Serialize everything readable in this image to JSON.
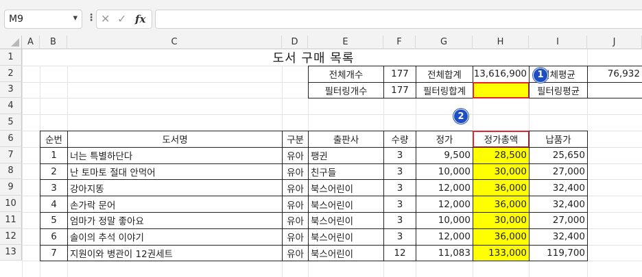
{
  "formula_bar": {
    "name_box": "M9",
    "chevron": "▾",
    "more": "⋮",
    "cancel": "✕",
    "enter": "✓",
    "fx": "fx",
    "formula": ""
  },
  "columns": [
    "A",
    "B",
    "C",
    "D",
    "E",
    "F",
    "G",
    "H",
    "I",
    "J"
  ],
  "rows": [
    "1",
    "2",
    "3",
    "4",
    "5",
    "6",
    "7",
    "8",
    "9",
    "10",
    "11",
    "12",
    "13"
  ],
  "sheet": {
    "title": "도서 구매 목록",
    "summary": {
      "total_count_label": "전체개수",
      "total_count": "177",
      "total_sum_label": "전체합계",
      "total_sum": "13,616,900",
      "total_avg_label": "전체평균",
      "total_avg": "76,932",
      "filter_count_label": "필터링개수",
      "filter_count": "177",
      "filter_sum_label": "필터링합계",
      "filter_sum": "",
      "filter_avg_label": "필터링평균",
      "filter_avg": ""
    },
    "table_headers": [
      "순번",
      "도서명",
      "구분",
      "출판사",
      "수량",
      "정가",
      "정가총액",
      "납품가"
    ],
    "table_rows": [
      [
        "1",
        "너는 특별하단다",
        "유아",
        "팽귄",
        "3",
        "9,500",
        "28,500",
        "25,650"
      ],
      [
        "2",
        "난 토마토 절대 안먹어",
        "유아",
        "친구들",
        "3",
        "10,000",
        "30,000",
        "27,000"
      ],
      [
        "3",
        "강아지똥",
        "유아",
        "북스어린이",
        "3",
        "12,000",
        "36,000",
        "32,400"
      ],
      [
        "4",
        "손가락 문어",
        "유아",
        "북스어린이",
        "3",
        "12,000",
        "36,000",
        "32,400"
      ],
      [
        "5",
        "엄마가 정말 좋아요",
        "유아",
        "북스어린이",
        "3",
        "10,000",
        "30,000",
        "27,000"
      ],
      [
        "6",
        "솔이의 추석 이야기",
        "유아",
        "북스어린이",
        "3",
        "12,000",
        "36,000",
        "32,400"
      ],
      [
        "7",
        "지원이와 병관이 12권세트",
        "유아",
        "북스어린이",
        "12",
        "11,083",
        "133,000",
        "119,700"
      ]
    ]
  },
  "badges": [
    "1",
    "2"
  ],
  "colors": {
    "highlight": "#ffff00",
    "selection_border": "#e8202a",
    "badge": "#1e4fc2"
  }
}
